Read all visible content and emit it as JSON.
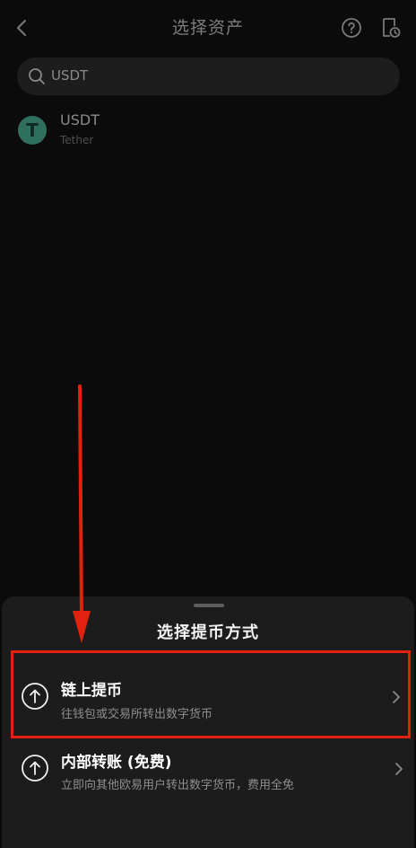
{
  "header": {
    "title": "选择资产",
    "back_icon": "chevron-left-icon",
    "help_icon": "question-circle-icon",
    "history_icon": "history-document-icon"
  },
  "search": {
    "value": "USDT",
    "icon": "search-icon"
  },
  "assets": [
    {
      "name": "USDT",
      "subtitle": "Tether",
      "logo_letter": "T",
      "logo_color": "#2f6f5e"
    }
  ],
  "sheet": {
    "title": "选择提币方式",
    "options": [
      {
        "title": "链上提币",
        "subtitle": "往钱包或交易所转出数字货币",
        "icon": "upload-circle-icon",
        "highlighted": true
      },
      {
        "title": "内部转账 (免费)",
        "subtitle": "立即向其他欧易用户转出数字货币，费用全免",
        "icon": "upload-circle-icon",
        "highlighted": false
      }
    ]
  },
  "colors": {
    "background": "#0b0b0b",
    "sheet": "#1c1c1c",
    "annotation": "#e2220e"
  }
}
